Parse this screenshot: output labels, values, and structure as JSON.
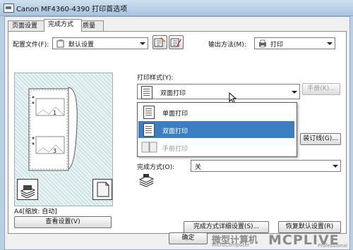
{
  "window": {
    "title": "Canon MF4360-4390 打印首选项"
  },
  "tabs": [
    {
      "label": "页面设置"
    },
    {
      "label": "完成方式"
    },
    {
      "label": "质量"
    }
  ],
  "profile": {
    "label": "配置文件(F):",
    "value": "默认设置"
  },
  "output": {
    "label": "输出方法(M):",
    "value": "打印"
  },
  "print_style": {
    "label": "打印样式(Y):",
    "value": "双面打印"
  },
  "booklet_button": "手册(K)...",
  "dropdown": {
    "options": [
      {
        "label": "单面打印",
        "state": "normal"
      },
      {
        "label": "双面打印",
        "state": "selected"
      },
      {
        "label": "手册打印",
        "state": "disabled"
      }
    ]
  },
  "gutter_button": "装订线(G)...",
  "finishing": {
    "label": "完成方式(O):",
    "value": "关"
  },
  "preview": {
    "page_numbers": [
      "1",
      "3"
    ],
    "scale_text": "A4[缩放: 自动]",
    "view_settings_button": "查看设置(V)"
  },
  "buttons": {
    "finishing_details": "完成方式详细设置(S)...",
    "restore_defaults": "恢复默认设置(R)",
    "ok": "确定"
  },
  "watermark": {
    "text_cn": "微型计算机",
    "text_en": "MicroComputer",
    "logo": "MCPLIVE",
    "tagline": "Professional"
  },
  "colors": {
    "selection": "#3c7fc1",
    "title_gradient_top": "#cfe0f1",
    "preview_bg": "#e6f2f3"
  }
}
